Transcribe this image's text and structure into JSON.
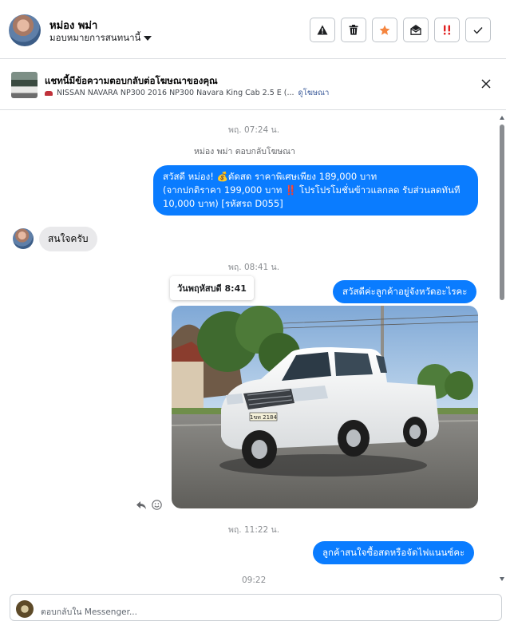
{
  "header": {
    "contact_name": "หม่อง พม่า",
    "assign_label": "มอบหมายการสนทนานี้",
    "action_icons": [
      "warning-icon",
      "trash-icon",
      "star-icon",
      "envelope-open-icon",
      "important-icon",
      "check-icon"
    ]
  },
  "ad": {
    "title": "แชทนี้มีข้อความตอบกลับต่อโฆษณาของคุณ",
    "subtitle": "NISSAN NAVARA NP300 2016 NP300 Navara King Cab 2.5 E (...",
    "link": "ดูโฆษณา"
  },
  "messages": {
    "time1": "พฤ. 07:24 น.",
    "reply_meta": "หม่อง พม่า ตอบกลับโฆษณา",
    "out1_line1": "สวัสดี หม่อง! 💰ดัดสด ราคาพิเศษเพียง 189,000 บาท",
    "out1_line2": "(จากปกติราคา 199,000 บาท ‼️ โปรโปรโมชั่นข้าวแลกลด รับส่วนลดทันที",
    "out1_line3": "10,000 บาท) [รหัสรถ D055]",
    "in1": "สนใจครับ",
    "time2": "พฤ. 08:41 น.",
    "tooltip": "วันพฤหัสบดี 8:41",
    "out2": "สวัสดีค่ะลูกค้าอยู่จังหวัดอะไรคะ",
    "plate": "1ขท 2184",
    "time3": "พฤ. 11:22 น.",
    "out3": "ลูกค้าสนใจซื้อสดหรือจัดไฟแนนซ์คะ",
    "time4": "09:22"
  },
  "composer": {
    "placeholder": "ตอบกลับใน Messenger..."
  },
  "colors": {
    "accent_blue": "#0a7cff",
    "incoming_gray": "#e9e9eb",
    "star_orange": "#f5853f",
    "important_red": "#e02020"
  }
}
